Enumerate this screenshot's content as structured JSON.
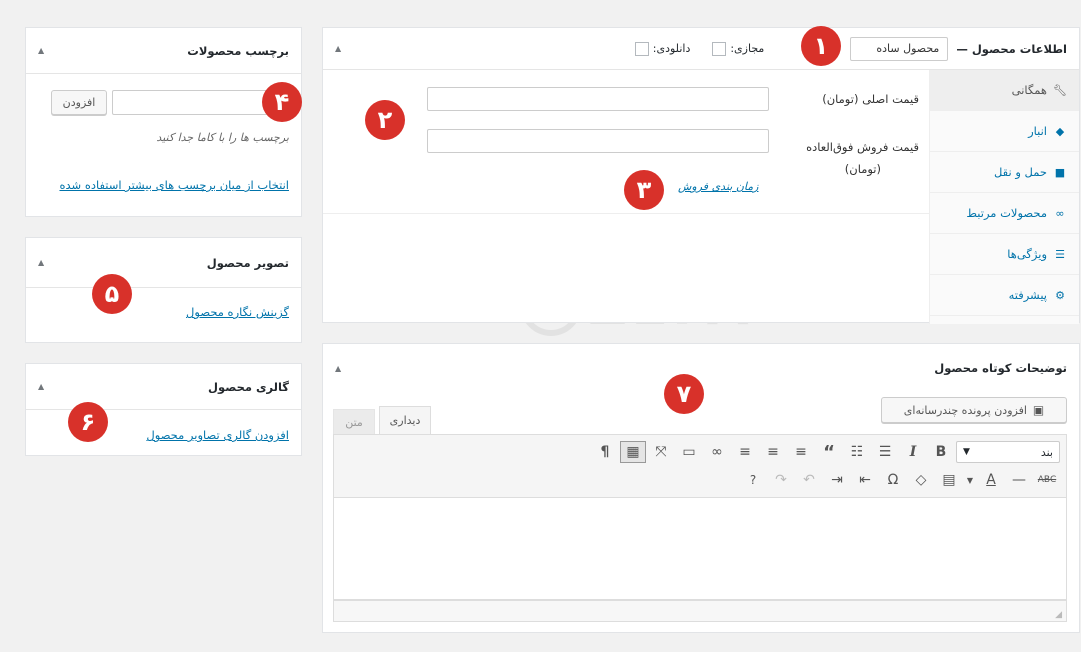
{
  "product_data": {
    "title": "اطلاعات محصول —",
    "product_type": "محصول ساده",
    "virtual_label": "مجازی:",
    "downloadable_label": "دانلودی:",
    "tabs": [
      {
        "label": "همگانی",
        "icon": "wrench-icon"
      },
      {
        "label": "انبار",
        "icon": "tag-icon"
      },
      {
        "label": "حمل و نقل",
        "icon": "truck-icon"
      },
      {
        "label": "محصولات مرتبط",
        "icon": "link-icon"
      },
      {
        "label": "ویژگی‌ها",
        "icon": "list-icon"
      },
      {
        "label": "پیشرفته",
        "icon": "gear-icon"
      }
    ],
    "regular_price_label": "قیمت اصلی (تومان)",
    "sale_price_label_line1": "قیمت فروش فوق‌العاده",
    "sale_price_label_line2": "(تومان)",
    "schedule_link": "زمان بندی فروش"
  },
  "short_description": {
    "title": "توضیحات کوتاه محصول",
    "add_media": "افزودن پرونده چندرسانه‌ای",
    "tab_visual": "دیداری",
    "tab_text": "متن",
    "format_select": "بند"
  },
  "product_tags": {
    "title": "برچسب محصولات",
    "add_button": "افزودن",
    "hint": "برچسب ها را با کاما جدا کنید",
    "choose_link": "انتخاب از میان برچسب های بیشتر استفاده شده"
  },
  "product_image": {
    "title": "تصویر محصول",
    "set_link": "گزینش نگاره محصول"
  },
  "product_gallery": {
    "title": "گالری محصول",
    "add_link": "افزودن گالری تصاویر محصول"
  },
  "callouts": [
    "۱",
    "۲",
    "۳",
    "۴",
    "۵",
    "۶",
    "۷"
  ],
  "watermark": "ZEFA",
  "colors": {
    "badge": "#d8312a",
    "link": "#0073aa"
  }
}
